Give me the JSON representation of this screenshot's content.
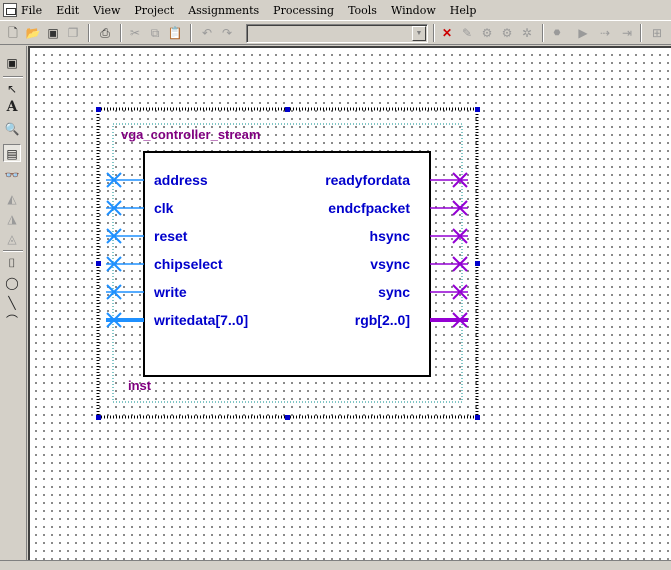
{
  "menu": {
    "items": [
      "File",
      "Edit",
      "View",
      "Project",
      "Assignments",
      "Processing",
      "Tools",
      "Window",
      "Help"
    ]
  },
  "toolbar": {
    "project_combo_value": ""
  },
  "symbol": {
    "module_name": "vga_controller_stream",
    "instance_name": "inst",
    "inputs": [
      "address",
      "clk",
      "reset",
      "chipselect",
      "write",
      "writedata[7..0]"
    ],
    "outputs": [
      "readyfordata",
      "endcfpacket",
      "hsync",
      "vsync",
      "sync",
      "rgb[2..0]"
    ]
  },
  "colors": {
    "port_text": "#0000cc",
    "module_name": "#800080",
    "input_wire": "#1e90ff",
    "output_wire": "#9400d3",
    "selection_handle": "#0000cc",
    "canvas_bg": "#ffffff",
    "chrome": "#d4d0c8"
  }
}
